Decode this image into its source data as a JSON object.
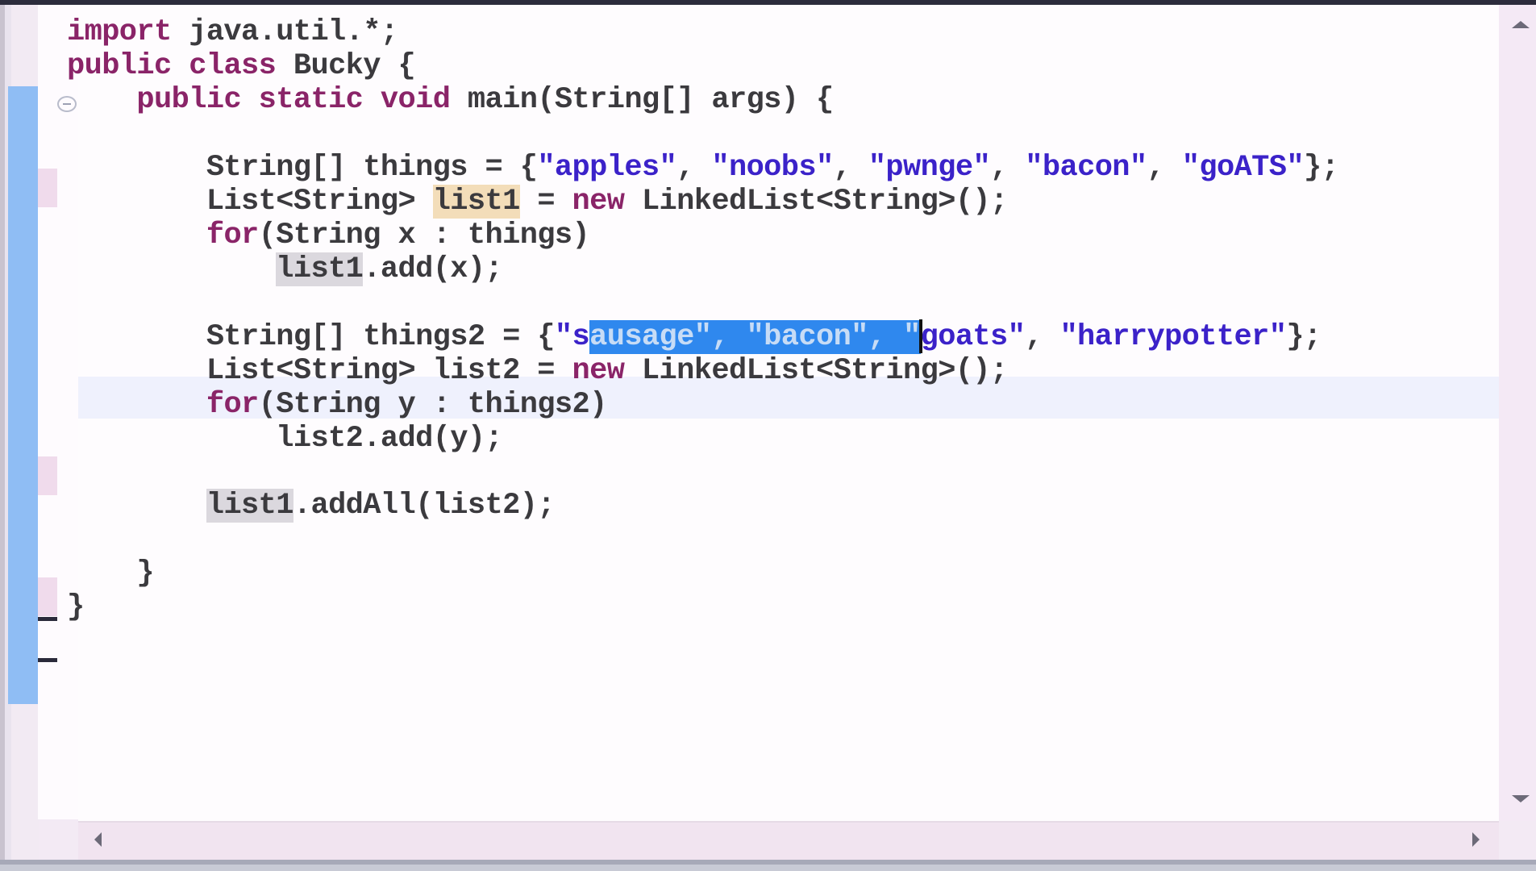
{
  "editor": {
    "language": "java",
    "lines": [
      {
        "tokens": [
          {
            "t": "import",
            "c": "kw"
          },
          {
            "t": " java.util.*;",
            "c": ""
          }
        ]
      },
      {
        "tokens": [
          {
            "t": "public",
            "c": "kw"
          },
          {
            "t": " ",
            "c": ""
          },
          {
            "t": "class",
            "c": "kw"
          },
          {
            "t": " Bucky {",
            "c": ""
          }
        ]
      },
      {
        "tokens": [
          {
            "t": "    ",
            "c": ""
          },
          {
            "t": "public",
            "c": "kw"
          },
          {
            "t": " ",
            "c": ""
          },
          {
            "t": "static",
            "c": "kw"
          },
          {
            "t": " ",
            "c": ""
          },
          {
            "t": "void",
            "c": "kw"
          },
          {
            "t": " main(String[] args) {",
            "c": ""
          }
        ]
      },
      {
        "tokens": []
      },
      {
        "tokens": [
          {
            "t": "        String[] things = {",
            "c": ""
          },
          {
            "t": "\"apples\"",
            "c": "str"
          },
          {
            "t": ", ",
            "c": ""
          },
          {
            "t": "\"noobs\"",
            "c": "str"
          },
          {
            "t": ", ",
            "c": ""
          },
          {
            "t": "\"pwnge\"",
            "c": "str"
          },
          {
            "t": ", ",
            "c": ""
          },
          {
            "t": "\"bacon\"",
            "c": "str"
          },
          {
            "t": ", ",
            "c": ""
          },
          {
            "t": "\"goATS\"",
            "c": "str"
          },
          {
            "t": "};",
            "c": ""
          }
        ]
      },
      {
        "tokens": [
          {
            "t": "        List<String> ",
            "c": ""
          },
          {
            "t": "list1",
            "c": "hl-occ"
          },
          {
            "t": " = ",
            "c": ""
          },
          {
            "t": "new",
            "c": "kw"
          },
          {
            "t": " LinkedList<String>();",
            "c": ""
          }
        ]
      },
      {
        "tokens": [
          {
            "t": "        ",
            "c": ""
          },
          {
            "t": "for",
            "c": "kw"
          },
          {
            "t": "(String x : things)",
            "c": ""
          }
        ]
      },
      {
        "tokens": [
          {
            "t": "            ",
            "c": ""
          },
          {
            "t": "list1",
            "c": "hl-ref"
          },
          {
            "t": ".add(x);",
            "c": ""
          }
        ]
      },
      {
        "tokens": []
      },
      {
        "tokens": [
          {
            "t": "        String[] things2 = {",
            "c": ""
          },
          {
            "t": "\"s",
            "c": "str"
          },
          {
            "t": "ausage\", \"bacon\", \"",
            "c": "sel"
          },
          {
            "t": "",
            "c": "caret"
          },
          {
            "t": "goats\"",
            "c": "str"
          },
          {
            "t": ", ",
            "c": ""
          },
          {
            "t": "\"harrypotter\"",
            "c": "str"
          },
          {
            "t": "};",
            "c": ""
          }
        ],
        "current": true
      },
      {
        "tokens": [
          {
            "t": "        List<String> list2 = ",
            "c": ""
          },
          {
            "t": "new",
            "c": "kw"
          },
          {
            "t": " LinkedList<String>();",
            "c": ""
          }
        ]
      },
      {
        "tokens": [
          {
            "t": "        ",
            "c": ""
          },
          {
            "t": "for",
            "c": "kw"
          },
          {
            "t": "(String y : things2)",
            "c": ""
          }
        ]
      },
      {
        "tokens": [
          {
            "t": "            list2.add(y);",
            "c": ""
          }
        ]
      },
      {
        "tokens": []
      },
      {
        "tokens": [
          {
            "t": "        ",
            "c": ""
          },
          {
            "t": "list1",
            "c": "hl-ref"
          },
          {
            "t": ".addAll(list2);",
            "c": ""
          }
        ]
      },
      {
        "tokens": []
      },
      {
        "tokens": [
          {
            "t": "    }",
            "c": ""
          }
        ]
      },
      {
        "tokens": [
          {
            "t": "}",
            "c": ""
          }
        ]
      }
    ],
    "selected_text": "ausage\", \"bacon\", \""
  },
  "icons": {
    "fold": "collapse-minus-icon",
    "scroll_up": "arrow-up-icon",
    "scroll_down": "arrow-down-icon",
    "scroll_left": "arrow-left-icon",
    "scroll_right": "arrow-right-icon"
  },
  "colors": {
    "keyword": "#8a2468",
    "string": "#3b22c9",
    "selection": "#2f88ee",
    "occurrence_highlight": "#f3ddb9",
    "reference_highlight": "#dbd8de",
    "overview_ruler": "#8fbdf4",
    "current_line": "#eff1fd"
  }
}
